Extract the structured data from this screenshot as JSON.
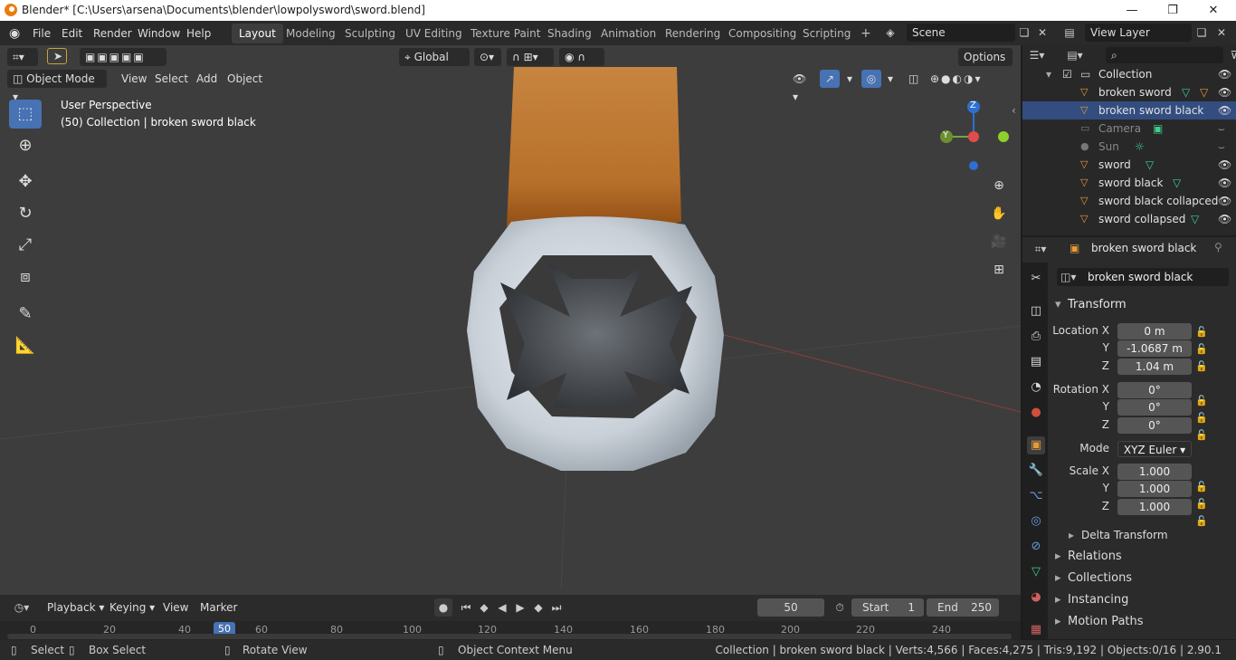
{
  "window": {
    "title": "Blender* [C:\\Users\\arsena\\Documents\\blender\\lowpolysword\\sword.blend]"
  },
  "menu": [
    "File",
    "Edit",
    "Render",
    "Window",
    "Help"
  ],
  "workspaces": [
    "Layout",
    "Modeling",
    "Sculpting",
    "UV Editing",
    "Texture Paint",
    "Shading",
    "Animation",
    "Rendering",
    "Compositing",
    "Scripting"
  ],
  "scene": "Scene",
  "view_layer": "View Layer",
  "viewport": {
    "orientation": "Global",
    "options": "Options",
    "mode": "Object Mode",
    "menus": [
      "View",
      "Select",
      "Add",
      "Object"
    ],
    "info_line1": "User Perspective",
    "info_line2": "(50) Collection | broken sword black",
    "gizmo_z": "Z",
    "gizmo_y": "Y"
  },
  "outliner": {
    "collection": "Collection",
    "items": [
      {
        "name": "broken sword"
      },
      {
        "name": "broken sword black"
      },
      {
        "name": "Camera"
      },
      {
        "name": "Sun"
      },
      {
        "name": "sword"
      },
      {
        "name": "sword black"
      },
      {
        "name": "sword black collapced"
      },
      {
        "name": "sword collapsed"
      }
    ]
  },
  "properties": {
    "object_name": "broken sword black",
    "data_name": "broken sword black",
    "transform": "Transform",
    "labels": {
      "loc": "Location X",
      "y": "Y",
      "z": "Z",
      "rot": "Rotation X",
      "mode": "Mode",
      "scale": "Scale X"
    },
    "location": [
      "0 m",
      "-1.0687 m",
      "1.04 m"
    ],
    "rotation": [
      "0°",
      "0°",
      "0°"
    ],
    "rotation_mode": "XYZ Euler",
    "scale": [
      "1.000",
      "1.000",
      "1.000"
    ],
    "panels": [
      "Delta Transform",
      "Relations",
      "Collections",
      "Instancing",
      "Motion Paths"
    ]
  },
  "timeline": {
    "menus": [
      "Playback",
      "Keying",
      "View",
      "Marker"
    ],
    "current_frame": "50",
    "start_label": "Start",
    "start": "1",
    "end_label": "End",
    "end": "250",
    "ruler": [
      "0",
      "20",
      "40",
      "50",
      "60",
      "80",
      "100",
      "120",
      "140",
      "160",
      "180",
      "200",
      "220",
      "240"
    ]
  },
  "status": {
    "select": "Select",
    "box_select": "Box Select",
    "rotate": "Rotate View",
    "context": "Object Context Menu",
    "stats": "Collection | broken sword black | Verts:4,566 | Faces:4,275 | Tris:9,192 | Objects:0/16 | 2.90.1"
  }
}
